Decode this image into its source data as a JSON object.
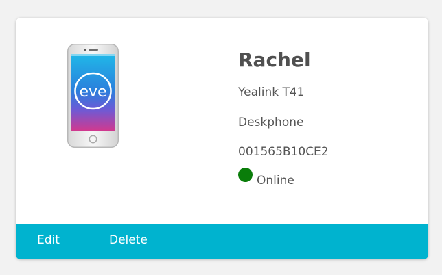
{
  "device_card": {
    "name": "Rachel",
    "model": "Yealink T41",
    "type": "Deskphone",
    "mac": "001565B10CE2",
    "status": "Online",
    "image_label": "eve",
    "actions": {
      "edit": "Edit",
      "delete": "Delete"
    }
  },
  "colors": {
    "accent": "#00b3cf",
    "online": "#0a7d0a",
    "text": "#555555",
    "name_text": "#505050"
  },
  "icons": {
    "device_image": "mobile-phone-image",
    "status": "status-dot-icon"
  }
}
